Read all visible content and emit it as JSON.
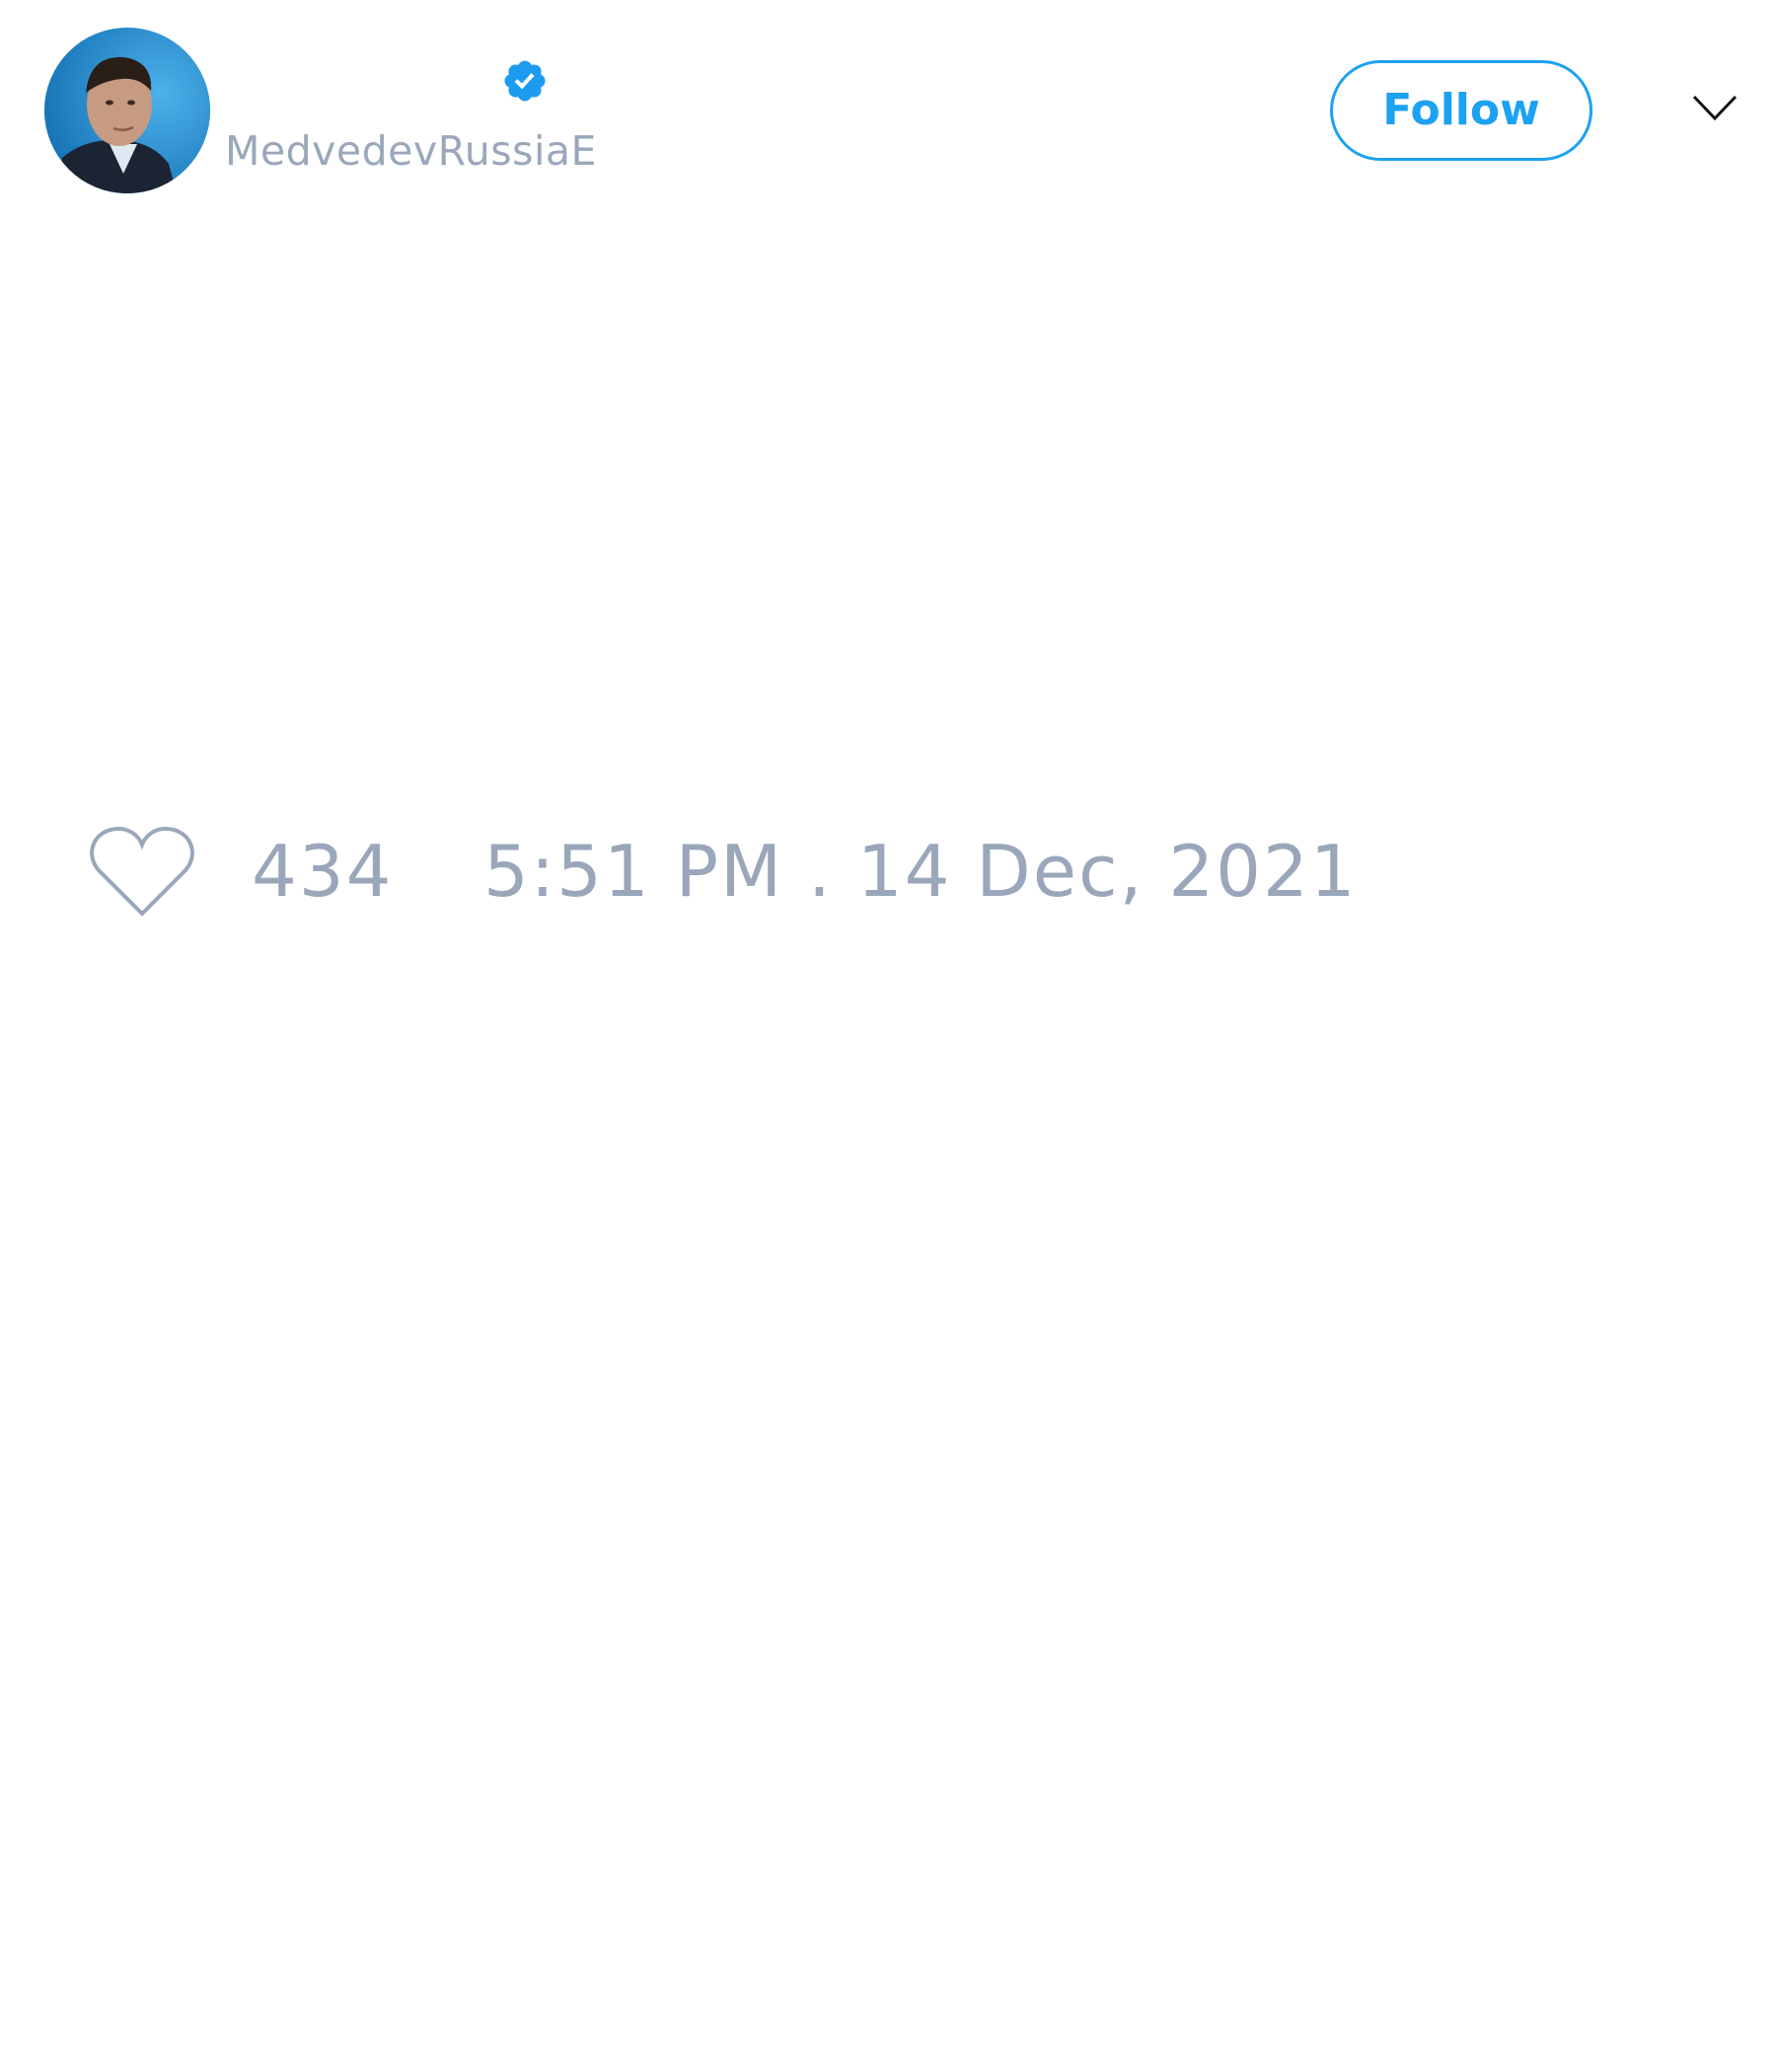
{
  "profile": {
    "display_name": "",
    "handle": "MedvedevRussiaE",
    "verified_icon": "verified-badge-icon",
    "avatar_icon": "profile-photo"
  },
  "actions": {
    "follow_label": "Follow",
    "more_icon": "chevron-down-icon"
  },
  "tweet_meta": {
    "like_icon": "heart-outline-icon",
    "like_count": "434",
    "timestamp": "5:51 PM . 14 Dec, 2021"
  },
  "colors": {
    "accent": "#1da1f2",
    "muted_text": "#9aa7bb",
    "background": "#ffffff"
  }
}
